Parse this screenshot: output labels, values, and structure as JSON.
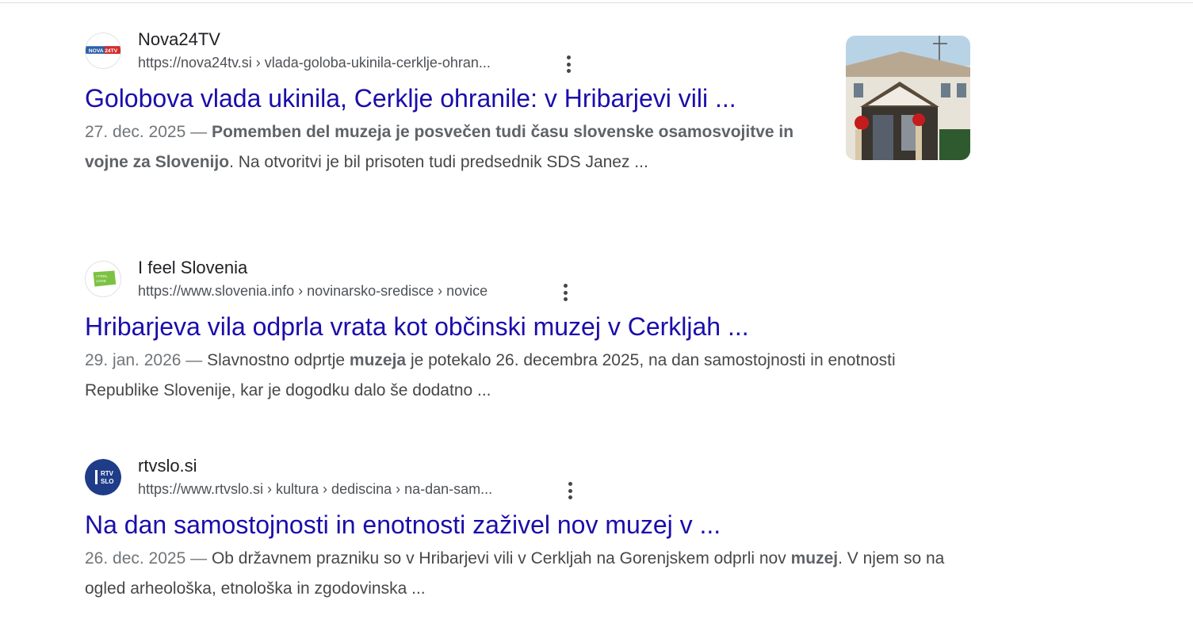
{
  "results": [
    {
      "site_name": "Nova24TV",
      "url": "https://nova24tv.si › vlada-goloba-ukinila-cerklje-ohran...",
      "title": "Golobova vlada ukinila, Cerklje ohranile: v Hribarjevi vili ...",
      "date": "27. dec. 2025 — ",
      "snippet_bold": "Pomemben del muzeja je posvečen tudi času slovenske osamosvojitve in vojne za Slovenijo",
      "snippet_rest": ". Na otvoritvi je bil prisoten tudi predsednik SDS Janez ...",
      "favicon_text": "NOVA 24TV",
      "favicon_icon": "nova24tv-logo-icon",
      "thumbnail": "building-photo-thumbnail"
    },
    {
      "site_name": "I feel Slovenia",
      "url": "https://www.slovenia.info › novinarsko-sredisce › novice",
      "title": "Hribarjeva vila odprla vrata kot občinski muzej v Cerkljah ...",
      "date": "29. jan. 2026 — ",
      "snippet_a": "Slavnostno odprtje ",
      "snippet_bold": "muzeja",
      "snippet_b": " je potekalo 26. decembra 2025, na dan samostojnosti in enotnosti Republike Slovenije, kar je dogodku dalo še dodatno ...",
      "favicon_text": "I FEEL LOVE",
      "favicon_icon": "ifeelslovenia-logo-icon"
    },
    {
      "site_name": "rtvslo.si",
      "url": "https://www.rtvslo.si › kultura › dediscina › na-dan-sam...",
      "title": "Na dan samostojnosti in enotnosti zaživel nov muzej v ...",
      "date": "26. dec. 2025 — ",
      "snippet_a": "Ob državnem prazniku so v Hribarjevi vili v Cerkljah na Gorenjskem odprli nov ",
      "snippet_bold": "muzej",
      "snippet_b": ". V njem so na ogled arheološka, etnološka in zgodovinska ...",
      "favicon_text": "RTV SLO",
      "favicon_icon": "rtvslo-logo-icon"
    }
  ],
  "colors": {
    "link": "#1a0dab",
    "text": "#474747",
    "muted": "#70757a"
  }
}
